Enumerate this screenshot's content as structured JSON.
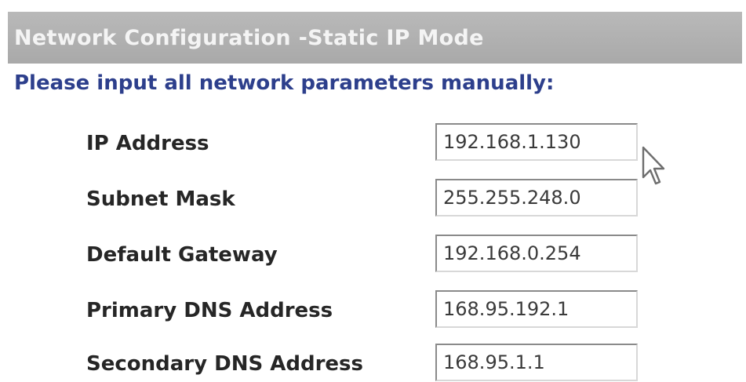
{
  "header": {
    "title": "Network Configuration -Static IP Mode"
  },
  "instruction": "Please input all network parameters manually:",
  "fields": [
    {
      "label": "IP Address",
      "value": "192.168.1.130"
    },
    {
      "label": "Subnet Mask",
      "value": "255.255.248.0"
    },
    {
      "label": "Default Gateway",
      "value": "192.168.0.254"
    },
    {
      "label": "Primary DNS Address",
      "value": "168.95.192.1"
    },
    {
      "label": "Secondary DNS Address",
      "value": "168.95.1.1"
    }
  ],
  "cursor": {
    "icon": "mouse-pointer-icon"
  },
  "colors": {
    "header_background": "#adadad",
    "header_text": "#f4f4f4",
    "instruction_text": "#2d3f8c",
    "label_text": "#262626"
  }
}
